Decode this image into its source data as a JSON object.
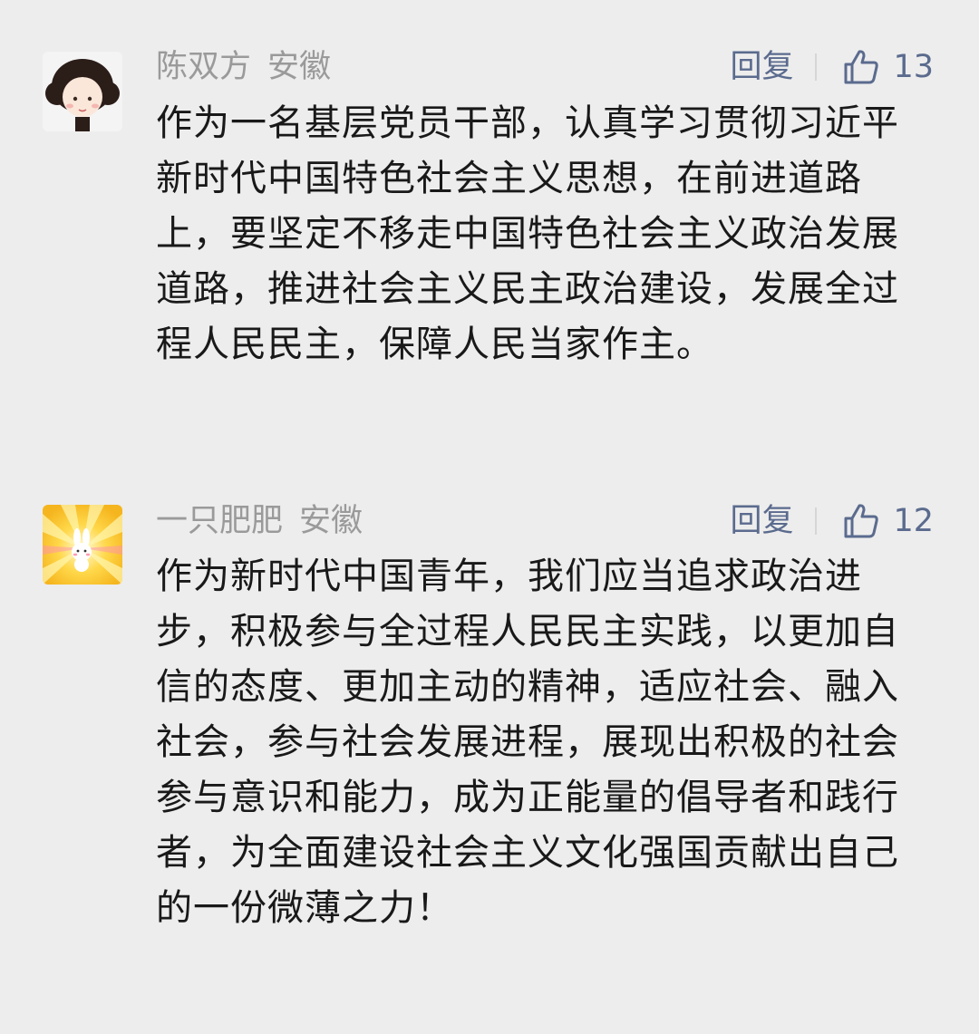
{
  "comments": [
    {
      "author": "陈双方",
      "region": "安徽",
      "reply_label": "回复",
      "likes": "13",
      "avatar_icon": "cartoon-girl-avatar",
      "text": "作为一名基层党员干部，认真学习贯彻习近平新时代中国特色社会主义思想，在前进道路上，要坚定不移走中国特色社会主义政治发展道路，推进社会主义民主政治建设，发展全过程人民民主，保障人民当家作主。"
    },
    {
      "author": "一只肥肥",
      "region": "安徽",
      "reply_label": "回复",
      "likes": "12",
      "avatar_icon": "cartoon-bunny-avatar",
      "text": "作为新时代中国青年，我们应当追求政治进步，积极参与全过程人民民主实践，以更加自信的态度、更加主动的精神，适应社会、融入社会，参与社会发展进程，展现出积极的社会参与意识和能力，成为正能量的倡导者和践行者，为全面建设社会主义文化强国贡献出自己的一份微薄之力！"
    }
  ],
  "colors": {
    "background": "#ededed",
    "link": "#5b6b8e",
    "meta": "#9a9a9a",
    "text": "#191919"
  }
}
